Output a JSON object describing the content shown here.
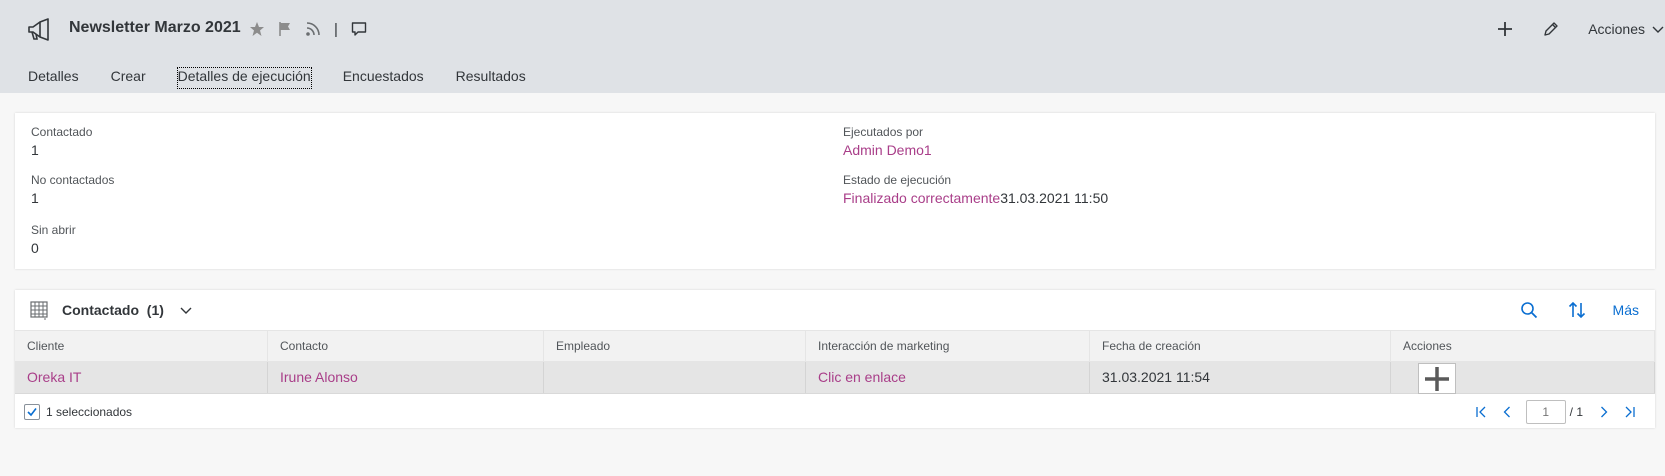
{
  "header": {
    "title": "Newsletter Marzo 2021",
    "acciones_label": "Acciones",
    "pipe": "|"
  },
  "tabs": [
    "Detalles",
    "Crear",
    "Detalles de ejecución",
    "Encuestados",
    "Resultados"
  ],
  "details": {
    "contactado_label": "Contactado",
    "contactado_value": "1",
    "no_contactados_label": "No contactados",
    "no_contactados_value": "1",
    "sin_abrir_label": "Sin abrir",
    "sin_abrir_value": "0",
    "ejecutados_por_label": "Ejecutados por",
    "ejecutados_por_value": "Admin Demo1",
    "estado_label": "Estado de ejecución",
    "estado_value": "Finalizado correctamente",
    "estado_timestamp": "31.03.2021 11:50"
  },
  "table": {
    "title": "Contactado",
    "count": "(1)",
    "mas_label": "Más",
    "columns": [
      "Cliente",
      "Contacto",
      "Empleado",
      "Interacción de marketing",
      "Fecha de creación",
      "Acciones"
    ],
    "rows": [
      {
        "cliente": "Oreka IT",
        "contacto": "Irune Alonso",
        "empleado": "",
        "interaccion": "Clic en enlace",
        "fecha": "31.03.2021 11:54"
      }
    ],
    "selected_text": "1 seleccionados",
    "page_input_placeholder": "1",
    "page_total": "/ 1"
  },
  "colors": {
    "header_bg": "#dfe2e6",
    "link": "#a93e89",
    "accent": "#0a6ed1",
    "row_selected_bg": "#e5e5e5"
  }
}
